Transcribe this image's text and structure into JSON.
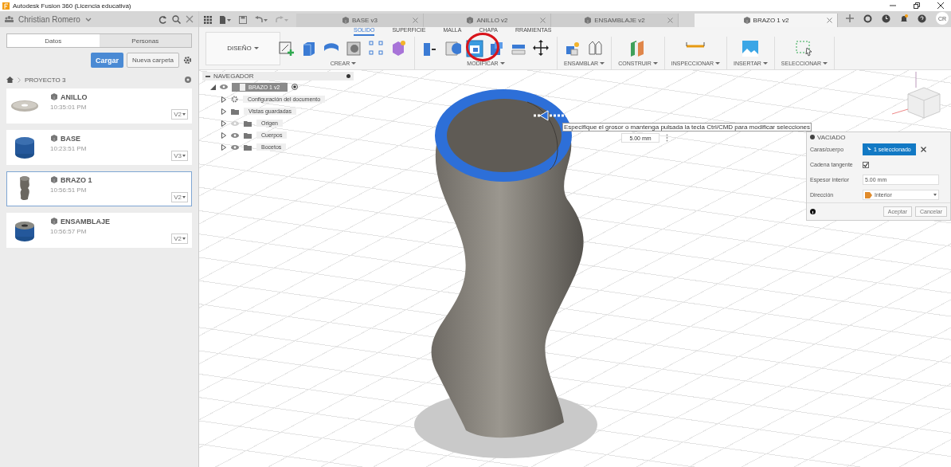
{
  "window": {
    "title": "Autodesk Fusion 360 (Licencia educativa)"
  },
  "data_panel": {
    "user": "Christian Romero",
    "tabs": [
      {
        "label": "Datos",
        "selected": true
      },
      {
        "label": "Personas",
        "selected": false
      }
    ],
    "upload_button": "Cargar",
    "new_folder_button": "Nueva carpeta",
    "breadcrumb": "PROYECTO 3",
    "files": [
      {
        "name": "ANILLO",
        "time": "10:35:01 PM",
        "version": "V2",
        "kind": "ring",
        "selected": false
      },
      {
        "name": "BASE",
        "time": "10:23:51 PM",
        "version": "V3",
        "kind": "cylinder",
        "selected": false
      },
      {
        "name": "BRAZO 1",
        "time": "10:56:51 PM",
        "version": "V2",
        "kind": "arm",
        "selected": true
      },
      {
        "name": "ENSAMBLAJE",
        "time": "10:56:57 PM",
        "version": "V2",
        "kind": "assembly",
        "selected": false
      }
    ]
  },
  "document_tabs": [
    {
      "label": "BASE v3",
      "selected": false
    },
    {
      "label": "ANILLO v2",
      "selected": false
    },
    {
      "label": "ENSAMBLAJE v2",
      "selected": false
    },
    {
      "label": "BRAZO 1 v2",
      "selected": true
    }
  ],
  "avatar": "CR",
  "toolbar": {
    "workspace": "DISEÑO",
    "tabs": [
      {
        "label": "SOLIDO",
        "selected": true
      },
      {
        "label": "SUPERFICIE",
        "selected": false
      },
      {
        "label": "MALLA",
        "selected": false
      },
      {
        "label": "CHAPA",
        "selected": false
      },
      {
        "label": "RRAMIENTAS",
        "selected": false
      }
    ],
    "groups": [
      {
        "label": "CREAR",
        "kind": "create"
      },
      {
        "label": "MODIFICAR",
        "kind": "modify"
      },
      {
        "label": "ENSAMBLAR",
        "kind": "assemble"
      },
      {
        "label": "CONSTRUIR",
        "kind": "construct"
      },
      {
        "label": "INSPECCIONAR",
        "kind": "inspect"
      },
      {
        "label": "INSERTAR",
        "kind": "insert"
      },
      {
        "label": "SELECCIONAR",
        "kind": "select"
      }
    ]
  },
  "navigator": {
    "title": "NAVEGADOR",
    "root": "BRAZO 1 v2",
    "children": [
      {
        "label": "Configuración del documento",
        "kind": "settings"
      },
      {
        "label": "Vistas guardadas",
        "kind": "folder"
      },
      {
        "label": "Origen",
        "kind": "folder",
        "visible": false
      },
      {
        "label": "Cuerpos",
        "kind": "folder",
        "visible": true
      },
      {
        "label": "Bocetos",
        "kind": "folder",
        "visible": true
      }
    ]
  },
  "tooltip": "Especifique el grosor o mantenga pulsada la tecla Ctrl/CMD para modificar selecciones",
  "thickness_input": "5.00 mm",
  "dialog": {
    "title": "VACIADO",
    "rows": [
      {
        "kind": "selection",
        "label": "Caras/cuerpo",
        "value": "1 seleccionado"
      },
      {
        "kind": "checkbox",
        "label": "Cadena tangente",
        "checked": true
      },
      {
        "kind": "input",
        "label": "Espesor interior",
        "value": "5.00 mm"
      },
      {
        "kind": "dropdown",
        "label": "Dirección",
        "value": "Interior"
      }
    ],
    "ok_button": "Aceptar",
    "cancel_button": "Cancelar"
  }
}
